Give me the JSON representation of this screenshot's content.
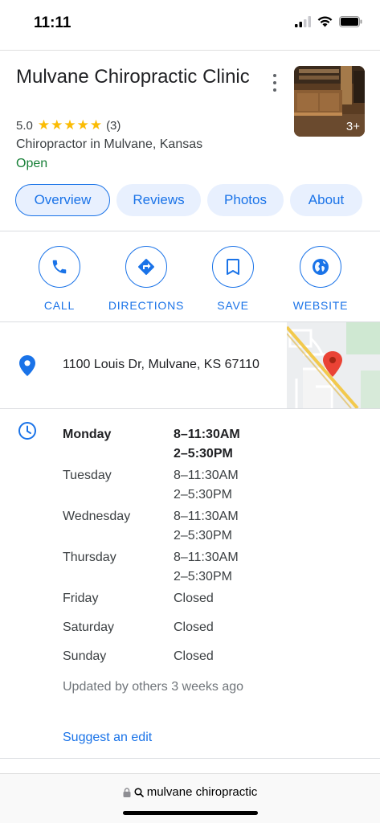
{
  "status": {
    "time": "11:11"
  },
  "business": {
    "name": "Mulvane Chiropractic Clinic",
    "rating": "5.0",
    "stars": "★★★★★",
    "reviews_count": "(3)",
    "category": "Chiropractor in Mulvane, Kansas",
    "open_status": "Open",
    "photo_count": "3+"
  },
  "tabs": [
    {
      "label": "Overview",
      "active": true
    },
    {
      "label": "Reviews"
    },
    {
      "label": "Photos"
    },
    {
      "label": "About"
    }
  ],
  "actions": [
    {
      "label": "CALL",
      "icon": "phone-icon"
    },
    {
      "label": "DIRECTIONS",
      "icon": "directions-icon"
    },
    {
      "label": "SAVE",
      "icon": "bookmark-icon"
    },
    {
      "label": "WEBSITE",
      "icon": "globe-icon"
    }
  ],
  "address": "1100 Louis Dr, Mulvane, KS 67110",
  "hours": [
    {
      "day": "Monday",
      "line1": "8–11:30AM",
      "line2": "2–5:30PM",
      "today": true
    },
    {
      "day": "Tuesday",
      "line1": "8–11:30AM",
      "line2": "2–5:30PM"
    },
    {
      "day": "Wednesday",
      "line1": "8–11:30AM",
      "line2": "2–5:30PM"
    },
    {
      "day": "Thursday",
      "line1": "8–11:30AM",
      "line2": "2–5:30PM"
    },
    {
      "day": "Friday",
      "line1": "Closed",
      "line2": ""
    },
    {
      "day": "Saturday",
      "line1": "Closed",
      "line2": ""
    },
    {
      "day": "Sunday",
      "line1": "Closed",
      "line2": ""
    }
  ],
  "updated_note": "Updated by others 3 weeks ago",
  "suggest_edit": "Suggest an edit",
  "browser": {
    "url": "mulvane chiropractic"
  },
  "colors": {
    "accent": "#1a73e8",
    "open": "#188038",
    "star": "#fbbc04",
    "pin": "#ea4335"
  }
}
